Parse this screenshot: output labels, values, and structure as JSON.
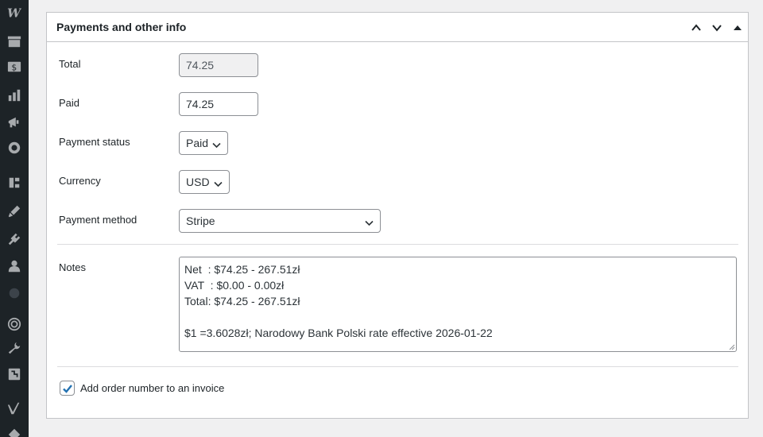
{
  "sidebar": {
    "icons": [
      "wordpress-logo-icon",
      "archive-icon",
      "invoice-icon",
      "analytics-icon",
      "megaphone-icon",
      "plugin-badge-icon",
      "elementor-icon",
      "brush-icon",
      "plugins-icon",
      "users-icon",
      "circle-icon",
      "fingerprint-icon",
      "tools-icon",
      "settings-icon",
      "yoast-icon",
      "diamond-icon"
    ]
  },
  "postbox": {
    "title": "Payments and other info"
  },
  "fields": {
    "total_label": "Total",
    "total_value": "74.25",
    "paid_label": "Paid",
    "paid_value": "74.25",
    "payment_status_label": "Payment status",
    "payment_status_value": "Paid",
    "currency_label": "Currency",
    "currency_value": "USD",
    "payment_method_label": "Payment method",
    "payment_method_value": "Stripe",
    "notes_label": "Notes",
    "notes_lines": [
      "Net  : $74.25 - 267.51zł",
      "VAT  : $0.00 - 0.00zł",
      "Total: $74.25 - 267.51zł",
      "",
      "$1 =3.6028zł; Narodowy Bank Polski rate effective 2026-01-22"
    ],
    "add_order_number_label": "Add order number to an invoice",
    "add_order_number_checked": true
  },
  "colors": {
    "sidebar_bg": "#1d2327",
    "accent": "#2271b1"
  }
}
